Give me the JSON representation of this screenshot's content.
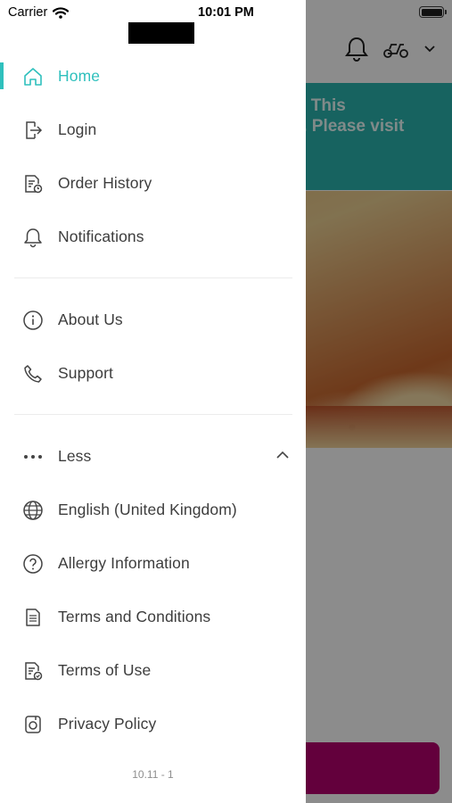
{
  "status_bar": {
    "carrier": "Carrier",
    "time": "10:01 PM"
  },
  "background": {
    "banner_text": "ed, This\non. Please visit",
    "accent_color": "#2bb5b0",
    "cta_color": "#b5006e"
  },
  "menu": {
    "active_color": "#2fc0bd",
    "primary": [
      {
        "label": "Home",
        "icon": "home-icon"
      },
      {
        "label": "Login",
        "icon": "login-icon"
      },
      {
        "label": "Order History",
        "icon": "order-history-icon"
      },
      {
        "label": "Notifications",
        "icon": "bell-icon"
      }
    ],
    "secondary": [
      {
        "label": "About Us",
        "icon": "info-icon"
      },
      {
        "label": "Support",
        "icon": "phone-icon"
      }
    ],
    "more": {
      "label": "Less",
      "icon": "more-dots-icon"
    },
    "tertiary": [
      {
        "label": "English (United Kingdom)",
        "icon": "globe-icon"
      },
      {
        "label": "Allergy Information",
        "icon": "question-circle-icon"
      },
      {
        "label": "Terms and Conditions",
        "icon": "document-icon"
      },
      {
        "label": "Terms of Use",
        "icon": "document-check-icon"
      },
      {
        "label": "Privacy Policy",
        "icon": "privacy-icon"
      }
    ]
  },
  "version": "10.11 - 1"
}
